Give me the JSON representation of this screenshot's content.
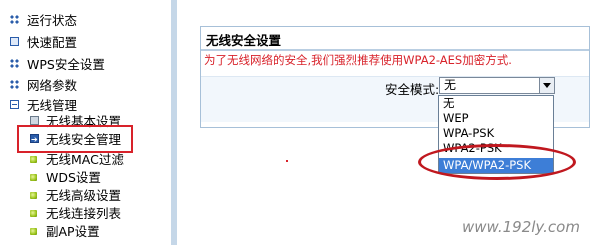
{
  "sidebar": {
    "items": [
      {
        "label": "运行状态"
      },
      {
        "label": "快速配置"
      },
      {
        "label": "WPS安全设置"
      },
      {
        "label": "网络参数"
      },
      {
        "label": "无线管理"
      },
      {
        "label": "无线基本设置"
      },
      {
        "label": "无线安全管理"
      },
      {
        "label": "无线MAC过滤"
      },
      {
        "label": "WDS设置"
      },
      {
        "label": "无线高级设置"
      },
      {
        "label": "无线连接列表"
      },
      {
        "label": "副AP设置"
      }
    ]
  },
  "panel": {
    "title": "无线安全设置",
    "notice": "为了无线网络的安全,我们强烈推荐使用WPA2-AES加密方式.",
    "mode_label": "安全模式:",
    "mode_value": "无"
  },
  "dropdown": {
    "options": [
      "无",
      "WEP",
      "WPA-PSK",
      "WPA2-PSK",
      "WPA/WPA2-PSK"
    ],
    "selected_index": 4
  },
  "watermark": "www.192ly.com",
  "colors": {
    "highlight_red": "#d8222a",
    "selection_blue": "#3d7ed7",
    "notice_red": "#d8222a"
  }
}
